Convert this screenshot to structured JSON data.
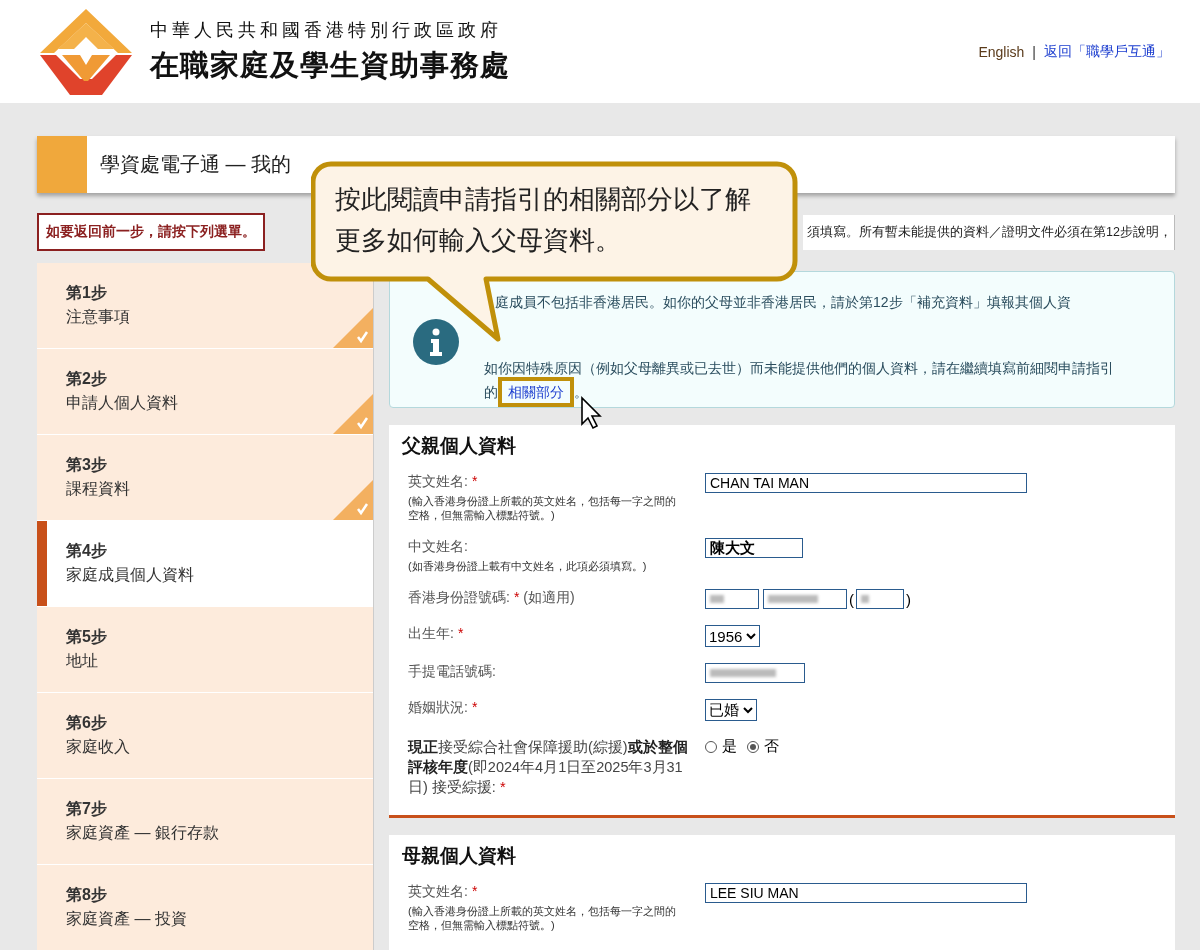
{
  "header": {
    "government": "中華人民共和國香港特別行政區政府",
    "agency": "在職家庭及學生資助事務處",
    "language_link": "English",
    "separator": "|",
    "return_link": "返回「職學戶互通」"
  },
  "page_title": "學資處電子通 — 我的",
  "back_notice": "如要返回前一步，請按下列選單。",
  "instruction": "須填寫。所有暫未能提供的資料／證明文件必須在第12步說明，",
  "steps": [
    {
      "number": "第1步",
      "name": "注意事項",
      "completed": true,
      "selected": false
    },
    {
      "number": "第2步",
      "name": "申請人個人資料",
      "completed": true,
      "selected": false
    },
    {
      "number": "第3步",
      "name": "課程資料",
      "completed": true,
      "selected": false
    },
    {
      "number": "第4步",
      "name": "家庭成員個人資料",
      "completed": false,
      "selected": true
    },
    {
      "number": "第5步",
      "name": "地址",
      "completed": false,
      "selected": false
    },
    {
      "number": "第6步",
      "name": "家庭收入",
      "completed": false,
      "selected": false
    },
    {
      "number": "第7步",
      "name": "家庭資產 — 銀行存款",
      "completed": false,
      "selected": false
    },
    {
      "number": "第8步",
      "name": "家庭資產 — 投資",
      "completed": false,
      "selected": false
    }
  ],
  "info_box": {
    "paragraph_1": "庭成員不包括非香港居民。如你的父母並非香港居民，請於第12步「補充資料」填報其個人資",
    "paragraph_2": "如你因特殊原因（例如父母離異或已去世）而未能提供他們的個人資料，請在繼續填寫前細閱申請指引的",
    "link": "相關部分",
    "link_highlighted": true,
    "after_link": "。"
  },
  "callout": {
    "text": "按此閱讀申請指引的相關部分以了解更多如何輸入父母資料。"
  },
  "required_mark": "*",
  "sections": [
    {
      "title": "父親個人資料",
      "fields": [
        {
          "kind": "wide_text",
          "label": "英文姓名:",
          "required": true,
          "hint": "(輸入香港身份證上所載的英文姓名，包括每一字之間的空格，但無需輸入標點符號。)",
          "value": "CHAN TAI MAN"
        },
        {
          "kind": "short_text",
          "label": "中文姓名:",
          "required": false,
          "hint": "(如香港身份證上載有中文姓名，此項必須填寫。)",
          "value": "陳大文"
        },
        {
          "kind": "hkid",
          "label": "香港身份證號碼:",
          "required": true,
          "note": "(如適用)",
          "open_bracket": "(",
          "close_bracket": ")"
        },
        {
          "kind": "select",
          "label": "出生年:",
          "required": true,
          "value": "1956"
        },
        {
          "kind": "redacted",
          "label": "手提電話號碼:",
          "required": false
        },
        {
          "kind": "select",
          "label": "婚姻狀況:",
          "required": true,
          "value": "已婚"
        },
        {
          "kind": "radio",
          "label": "**現正**接受綜合社會保障援助(綜援)**或於整個評核年度**(即2024年4月1日至2025年3月31日) 接受綜援:",
          "required": true,
          "options": [
            {
              "label": "是",
              "selected": false
            },
            {
              "label": "否",
              "selected": true
            }
          ]
        }
      ]
    },
    {
      "title": "母親個人資料",
      "fields": [
        {
          "kind": "wide_text",
          "label": "英文姓名:",
          "required": true,
          "hint": "(輸入香港身份證上所載的英文姓名，包括每一字之間的空格，但無需輸入標點符號。)",
          "value": "LEE SIU MAN"
        }
      ]
    }
  ]
}
